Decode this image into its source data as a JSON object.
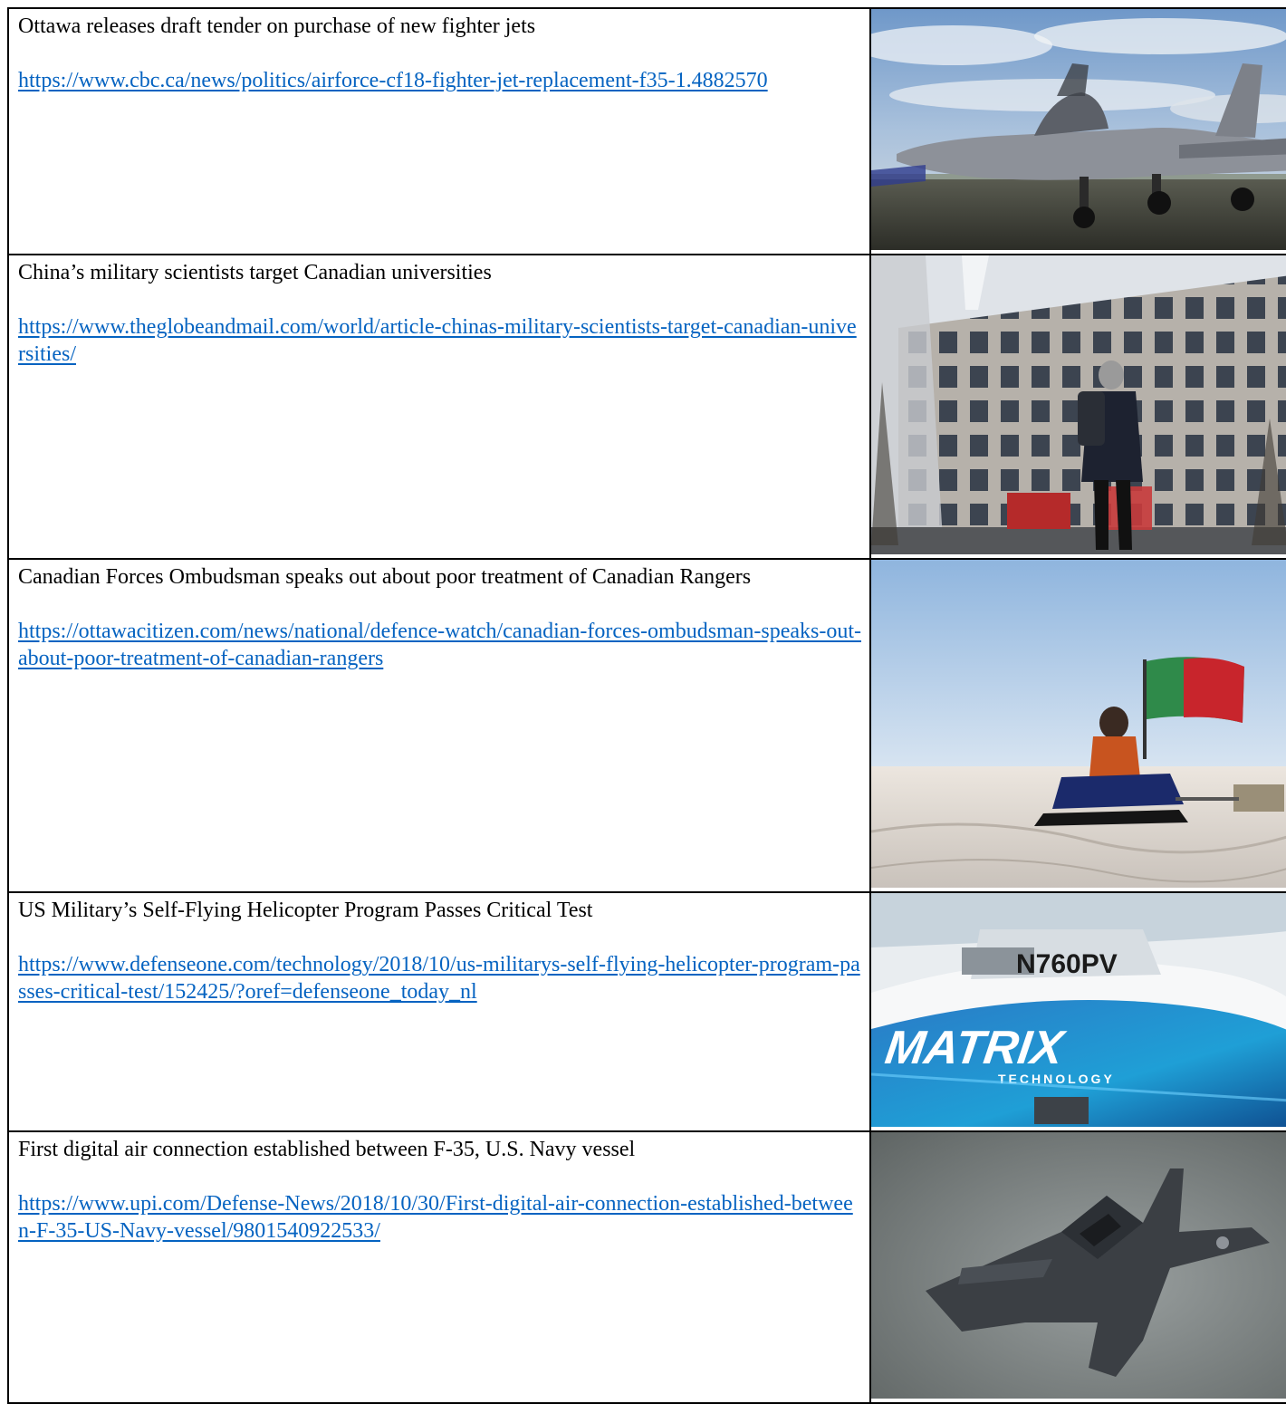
{
  "articles": [
    {
      "headline": "Ottawa releases draft tender on purchase of new fighter jets",
      "url": "https://www.cbc.ca/news/politics/airforce-cf18-fighter-jet-replacement-f35-1.4882570",
      "image_icon": "fighter-jet-on-tarmac-image"
    },
    {
      "headline": "China’s military scientists target Canadian universities",
      "url": "https://www.theglobeandmail.com/world/article-chinas-military-scientists-target-canadian-universities/",
      "image_icon": "university-building-image"
    },
    {
      "headline": "Canadian Forces Ombudsman speaks out about poor treatment of Canadian Rangers",
      "url": "https://ottawacitizen.com/news/national/defence-watch/canadian-forces-ombudsman-speaks-out-about-poor-treatment-of-canadian-rangers",
      "image_icon": "snowmobile-flag-image"
    },
    {
      "headline": "US Military’s Self-Flying Helicopter Program Passes Critical Test",
      "url": "https://www.defenseone.com/technology/2018/10/us-militarys-self-flying-helicopter-program-passes-critical-test/152425/?oref=defenseone_today_nl",
      "image_icon": "helicopter-image",
      "image_text": {
        "tail_number": "N760PV",
        "brand": "MATRIX",
        "brand_sub": "TECHNOLOGY"
      }
    },
    {
      "headline": "First digital air connection established between F-35, U.S. Navy vessel",
      "url": "https://www.upi.com/Defense-News/2018/10/30/First-digital-air-connection-established-between-F-35-US-Navy-vessel/9801540922533/",
      "image_icon": "f35-in-flight-image"
    }
  ],
  "colors": {
    "link": "#0563c1",
    "border": "#000000",
    "text": "#000000"
  }
}
